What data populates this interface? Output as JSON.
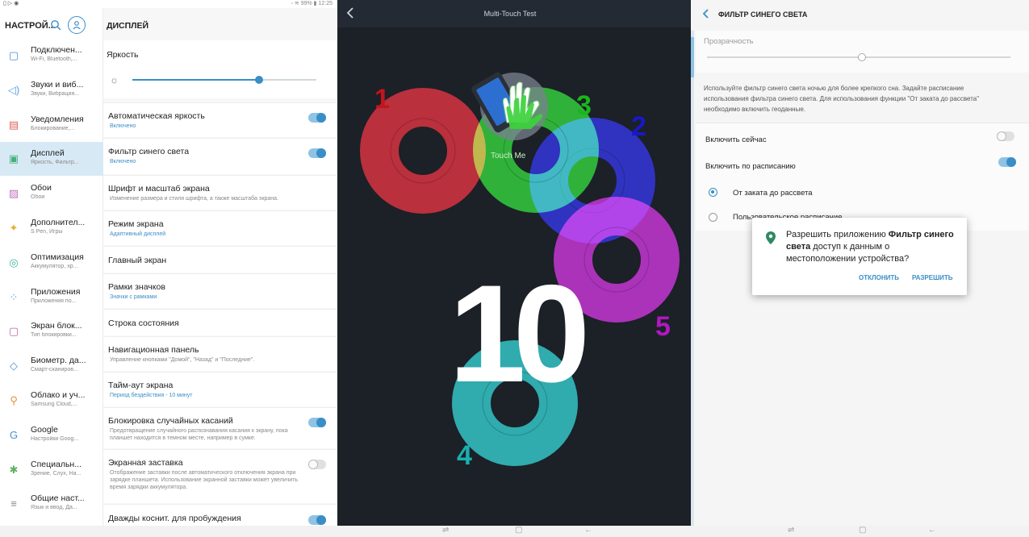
{
  "settings": {
    "status_left": "▯ ▷ ◉",
    "status_right": "◦ ≋ 99% ▮ 12:25",
    "sidebar_title": "НАСТРОЙ...",
    "search_icon": "search-icon",
    "account_icon": "account-icon",
    "items": [
      {
        "label": "Подключен...",
        "sub": "Wi-Fi, Bluetooth,...",
        "icon": "▢",
        "color": "#4a90d0"
      },
      {
        "label": "Звуки и виб...",
        "sub": "Звуки, Вибрация...",
        "icon": "◁)",
        "color": "#5aa0e0"
      },
      {
        "label": "Уведомления",
        "sub": "Блокирование,...",
        "icon": "▤",
        "color": "#e0605a"
      },
      {
        "label": "Дисплей",
        "sub": "Яркость, Фильтр...",
        "icon": "▣",
        "color": "#46b07a"
      },
      {
        "label": "Обои",
        "sub": "Обои",
        "icon": "▨",
        "color": "#c070c0"
      },
      {
        "label": "Дополнител...",
        "sub": "S Pen, Игры",
        "icon": "✦",
        "color": "#e8b030"
      },
      {
        "label": "Оптимизация",
        "sub": "Аккумулятор, хр...",
        "icon": "◎",
        "color": "#40b0a0"
      },
      {
        "label": "Приложения",
        "sub": "Приложения по...",
        "icon": "⁘",
        "color": "#5aa0e0"
      },
      {
        "label": "Экран блок...",
        "sub": "Тип блокировки...",
        "icon": "▢",
        "color": "#c060a0"
      },
      {
        "label": "Биометр. да...",
        "sub": "Смарт-сканиров...",
        "icon": "◇",
        "color": "#4a90d0"
      },
      {
        "label": "Облако и уч...",
        "sub": "Samsung Cloud,...",
        "icon": "⚲",
        "color": "#e89040"
      },
      {
        "label": "Google",
        "sub": "Настройки Goog...",
        "icon": "G",
        "color": "#4a90d0"
      },
      {
        "label": "Специальн...",
        "sub": "Зрение, Слух, На...",
        "icon": "✱",
        "color": "#60b060"
      },
      {
        "label": "Общие наст...",
        "sub": "Язык и ввод, Да...",
        "icon": "≡",
        "color": "#888888"
      }
    ],
    "content_title": "ДИСПЛЕЙ",
    "brightness_label": "Яркость",
    "brightness_level": 0.69,
    "rows": [
      {
        "label": "Автоматическая яркость",
        "sub": "Включено",
        "sub_blue": true,
        "toggle": "on"
      },
      {
        "label": "Фильтр синего света",
        "sub": "Включено",
        "sub_blue": true,
        "toggle": "on"
      },
      {
        "label": "Шрифт и масштаб экрана",
        "sub": "Изменение размера и стиля шрифта, а также масштаба экрана.",
        "sub_blue": false,
        "toggle": ""
      },
      {
        "label": "Режим экрана",
        "sub": "Адаптивный дисплей",
        "sub_blue": true,
        "toggle": ""
      },
      {
        "label": "Главный экран",
        "sub": "",
        "sub_blue": false,
        "toggle": ""
      },
      {
        "label": "Рамки значков",
        "sub": "Значки с рамками",
        "sub_blue": true,
        "toggle": ""
      },
      {
        "label": "Строка состояния",
        "sub": "",
        "sub_blue": false,
        "toggle": ""
      },
      {
        "label": "Навигационная панель",
        "sub": "Управление кнопками \"Домой\", \"Назад\" и \"Последние\".",
        "sub_blue": false,
        "toggle": ""
      },
      {
        "label": "Тайм-аут экрана",
        "sub": "Период бездействия - 10 минут",
        "sub_blue": true,
        "toggle": ""
      },
      {
        "label": "Блокировка случайных касаний",
        "sub": "Предотвращение случайного распознавания касания к экрану, пока планшет находится в темном месте, например в сумке.",
        "sub_blue": false,
        "toggle": "on"
      },
      {
        "label": "Экранная заставка",
        "sub": "Отображение заставки после автоматического отключения экрана при зарядке планшета. Использование экранной заставки может увеличить время зарядки аккумулятора.",
        "sub_blue": false,
        "toggle": "off"
      },
      {
        "label": "Дважды коснит. для пробуждения",
        "sub": "",
        "sub_blue": false,
        "toggle": "on"
      }
    ]
  },
  "multitouch": {
    "title": "Multi-Touch Test",
    "back_icon": "back-arrow-icon",
    "touch_me": "Touch Me",
    "touch_count": "10",
    "fingers": [
      {
        "num": "1",
        "color": "#c4141c"
      },
      {
        "num": "2",
        "color": "#1818c8"
      },
      {
        "num": "3",
        "color": "#18b818"
      },
      {
        "num": "4",
        "color": "#18b0b0"
      },
      {
        "num": "5",
        "color": "#b018c0"
      }
    ],
    "hand_icon": "hand-touch-icon"
  },
  "bluefilter": {
    "title": "ФИЛЬТР СИНЕГО СВЕТА",
    "back_icon": "back-chevron-icon",
    "opacity_label": "Прозрачность",
    "opacity_level": 0.51,
    "description": "Используйте фильтр синего света ночью для более крепкого сна. Задайте расписание использования фильтра синего света. Для использования функции \"От заката до рассвета\" необходимо включить геоданные.",
    "enable_now": "Включить сейчас",
    "enable_schedule": "Включить по расписанию",
    "option_sunset": "От заката до рассвета",
    "option_custom": "Пользовательское расписание",
    "dialog_pre": "Разрешить приложению ",
    "dialog_app": "Фильтр синего света",
    "dialog_post": " доступ к данным о местоположении устройства?",
    "deny": "ОТКЛОНИТЬ",
    "allow": "РАЗРЕШИТЬ",
    "pin_color": "#2e8a62"
  },
  "navbar": {
    "recent_icon": "recent-apps-icon",
    "home_icon": "home-icon",
    "back_icon": "back-icon"
  }
}
